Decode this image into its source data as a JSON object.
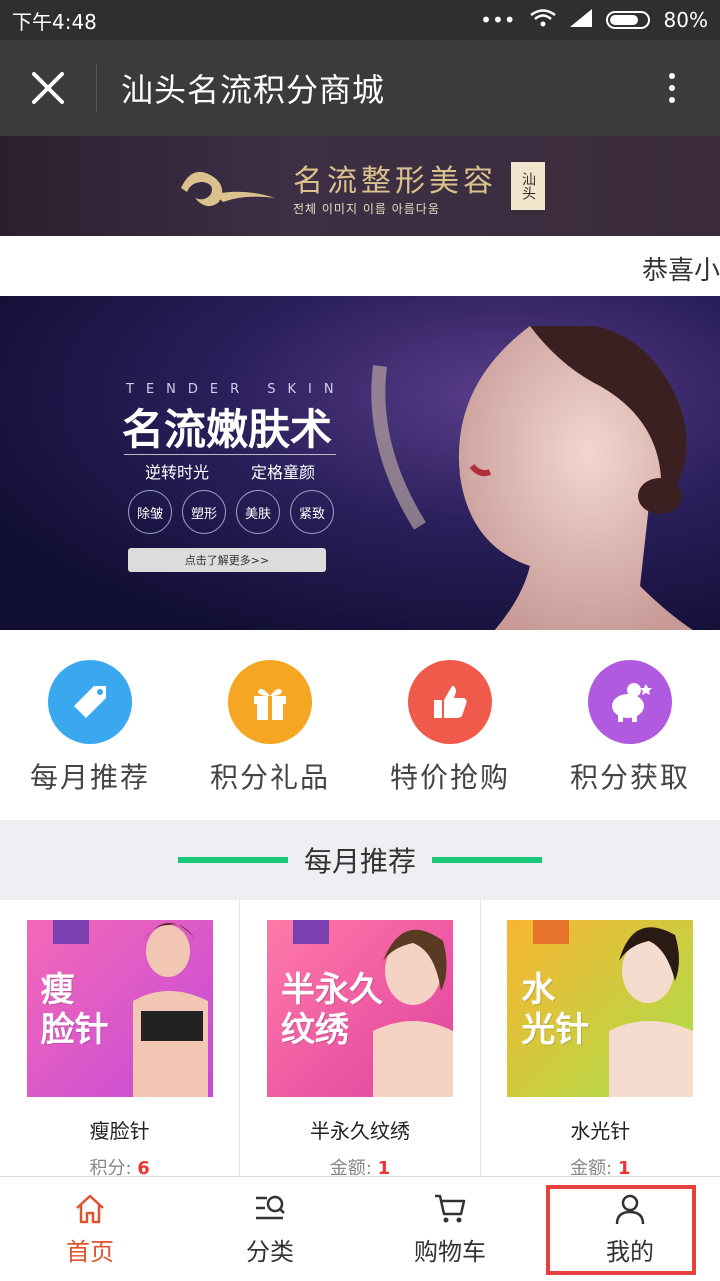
{
  "status_bar": {
    "time": "下午4:48",
    "battery": "80%"
  },
  "title_bar": {
    "title": "汕头名流积分商城"
  },
  "brand": {
    "name": "名流整形美容",
    "subtitle": "전체 이미지 이름 아름다움",
    "stamp": "汕头"
  },
  "marquee": {
    "text": "恭喜小"
  },
  "hero": {
    "tagline_en": "TENDER SKIN",
    "headline": "名流嫩肤术",
    "sub_left": "逆转时光",
    "sub_right": "定格童颜",
    "tags": [
      "除皱",
      "塑形",
      "美肤",
      "紧致"
    ],
    "cta": "点击了解更多>>"
  },
  "categories": [
    {
      "label": "每月推荐",
      "icon": "tag-icon",
      "color": "#3aa8ee"
    },
    {
      "label": "积分礼品",
      "icon": "gift-icon",
      "color": "#f5a623"
    },
    {
      "label": "特价抢购",
      "icon": "thumbs-up-icon",
      "color": "#f05a4a"
    },
    {
      "label": "积分获取",
      "icon": "piggy-bank-icon",
      "color": "#b05ae0"
    }
  ],
  "section": {
    "title": "每月推荐"
  },
  "products": [
    {
      "image_text": "瘦\n脸针",
      "name": "瘦脸针",
      "price_label": "积分:",
      "price_value": "6"
    },
    {
      "image_text": "半永久\n纹绣",
      "name": "半永久纹绣",
      "price_label": "金额:",
      "price_value": "1"
    },
    {
      "image_text": "水\n光针",
      "name": "水光针",
      "price_label": "金额:",
      "price_value": "1"
    }
  ],
  "tabs": [
    {
      "label": "首页",
      "icon": "home-icon"
    },
    {
      "label": "分类",
      "icon": "category-search-icon"
    },
    {
      "label": "购物车",
      "icon": "cart-icon"
    },
    {
      "label": "我的",
      "icon": "user-icon"
    }
  ]
}
